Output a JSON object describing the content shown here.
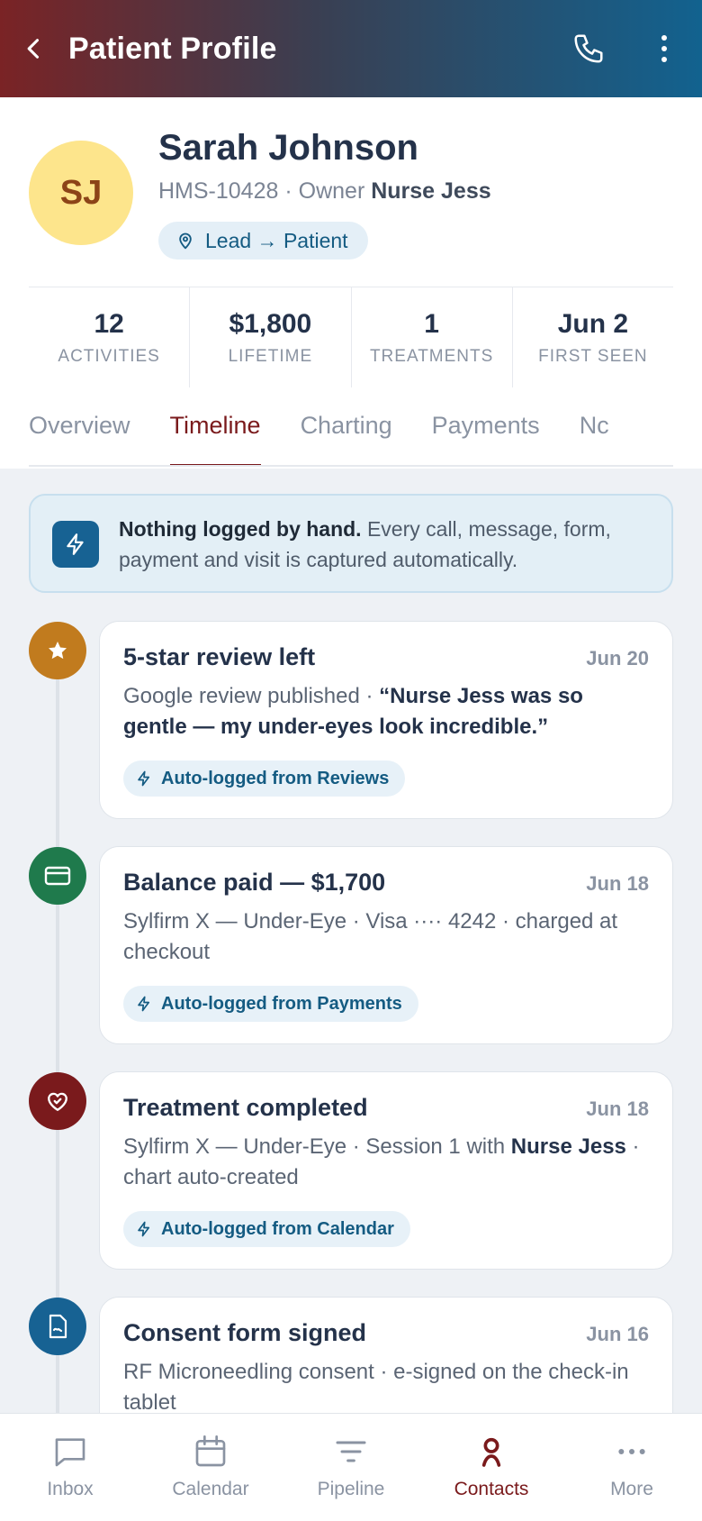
{
  "header": {
    "title": "Patient Profile",
    "back_icon": "chevron-left-icon",
    "call_icon": "phone-icon",
    "menu_icon": "more-vertical-icon"
  },
  "patient": {
    "initials": "SJ",
    "name": "Sarah Johnson",
    "id": "HMS-10428",
    "owner_prefix": "· Owner",
    "owner": "Nurse Jess",
    "badge": "Lead → Patient"
  },
  "stats": [
    {
      "value": "12",
      "label": "ACTIVITIES"
    },
    {
      "value": "$1,800",
      "label": "LIFETIME"
    },
    {
      "value": "1",
      "label": "TREATMENTS"
    },
    {
      "value": "Jun 2",
      "label": "FIRST SEEN"
    }
  ],
  "tabs": [
    "Overview",
    "Timeline",
    "Charting",
    "Payments",
    "Nc"
  ],
  "active_tab": "Timeline",
  "banner": {
    "bold": "Nothing logged by hand.",
    "text": " Every call, message, form, payment and visit is captured automatically."
  },
  "timeline": [
    {
      "title": "5-star review left",
      "date": "Jun 20",
      "desc_plain": "Google review published · ",
      "desc_bold": "“Nurse Jess was so gentle — my under-eyes look incredible.”",
      "desc_tail": "",
      "chip": "Auto-logged from Reviews",
      "color": "#c17b1e",
      "icon": "star-icon"
    },
    {
      "title": "Balance paid — $1,700",
      "date": "Jun 18",
      "desc_plain": "Sylfirm X — Under-Eye · Visa ···· 4242 · charged at checkout",
      "desc_bold": "",
      "desc_tail": "",
      "chip": "Auto-logged from Payments",
      "color": "#1f7a4c",
      "icon": "credit-card-icon"
    },
    {
      "title": "Treatment completed",
      "date": "Jun 18",
      "desc_plain": "Sylfirm X — Under-Eye · Session 1 with ",
      "desc_bold": "Nurse Jess",
      "desc_tail": " · chart auto-created",
      "chip": "Auto-logged from Calendar",
      "color": "#7a1a1c",
      "icon": "heart-icon"
    },
    {
      "title": "Consent form signed",
      "date": "Jun 16",
      "desc_plain": "RF Microneedling consent · e-signed on the check-in tablet",
      "desc_bold": "",
      "desc_tail": "",
      "chip": "",
      "color": "#176293",
      "icon": "document-icon"
    }
  ],
  "bottom_nav": [
    {
      "label": "Inbox",
      "icon": "chat-icon"
    },
    {
      "label": "Calendar",
      "icon": "calendar-icon"
    },
    {
      "label": "Pipeline",
      "icon": "filter-icon"
    },
    {
      "label": "Contacts",
      "icon": "person-icon"
    },
    {
      "label": "More",
      "icon": "more-horizontal-icon"
    }
  ],
  "active_nav": "Contacts"
}
